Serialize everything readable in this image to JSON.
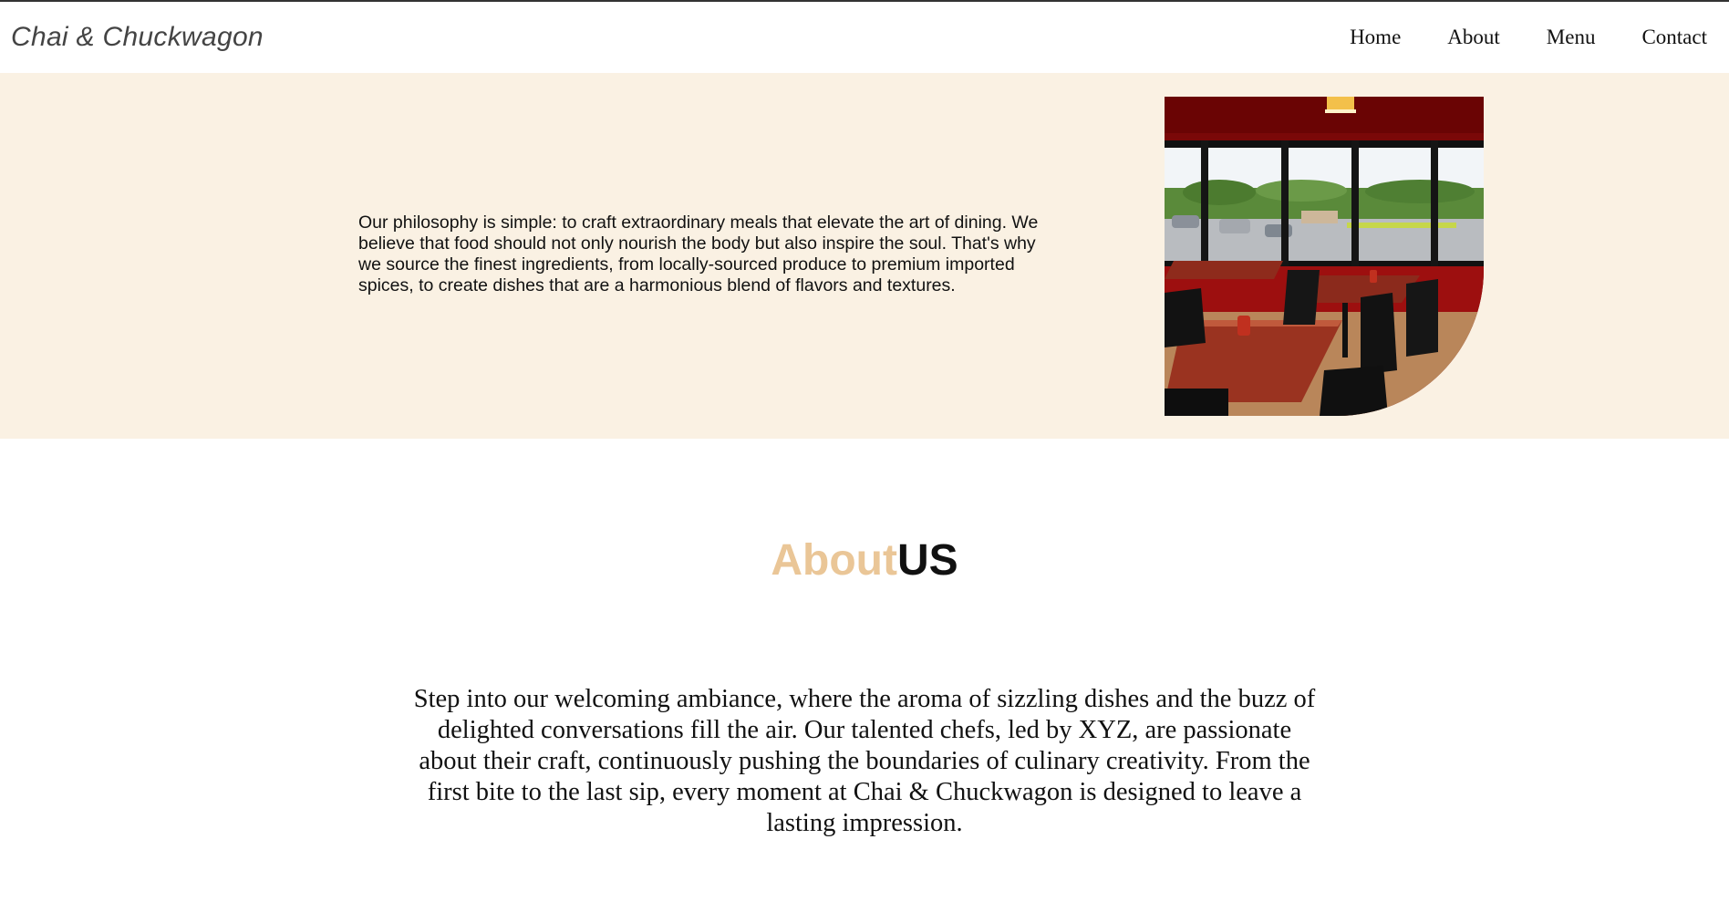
{
  "brand": {
    "name": "Chai & Chuckwagon"
  },
  "nav": {
    "items": [
      {
        "label": "Home"
      },
      {
        "label": "About"
      },
      {
        "label": "Menu"
      },
      {
        "label": "Contact"
      }
    ]
  },
  "hero": {
    "text": "Our philosophy is simple: to craft extraordinary meals that elevate the art of dining. We believe that food should not only nourish the body but also inspire the soul. That's why we source the finest ingredients, from locally-sourced produce to premium imported spices, to create dishes that are a harmonious blend of flavors and textures.",
    "image": "restaurant-interior-photo"
  },
  "about": {
    "title_accent": "About",
    "title_main": "US",
    "text": "Step into our welcoming ambiance, where the aroma of sizzling dishes and the buzz of delighted conversations fill the air. Our talented chefs, led by XYZ, are passionate about their craft, continuously pushing the boundaries of culinary creativity. From the first bite to the last sip, every moment at Chai & Chuckwagon is designed to leave a lasting impression."
  },
  "colors": {
    "hero_background": "#faf1e3",
    "title_accent": "#eac697",
    "wall_red": "#8b0a0a"
  }
}
